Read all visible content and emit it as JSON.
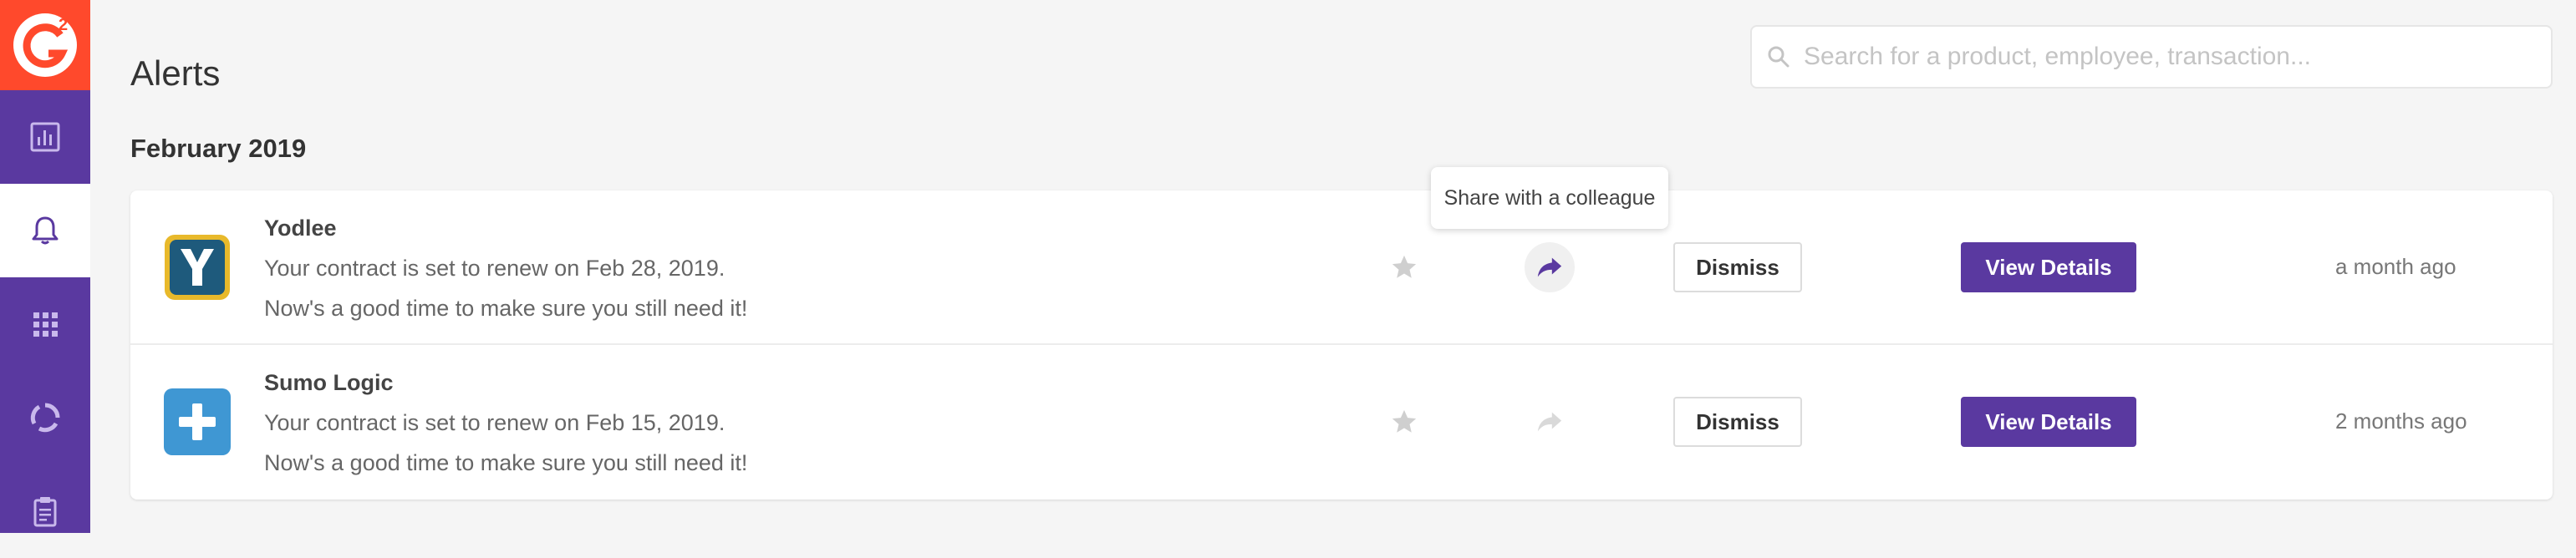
{
  "brand": {
    "logo_text": "G2",
    "logo_bg": "#ff492c",
    "accent": "#5a39a0"
  },
  "sidebar": {
    "items": [
      {
        "icon": "bar-chart-icon",
        "active": false
      },
      {
        "icon": "bell-icon",
        "active": true
      },
      {
        "icon": "grid-icon",
        "active": false
      },
      {
        "icon": "circle-progress-icon",
        "active": false
      },
      {
        "icon": "clipboard-icon",
        "active": false
      }
    ]
  },
  "search": {
    "placeholder": "Search for a product, employee, transaction..."
  },
  "page": {
    "title": "Alerts",
    "section": "February 2019"
  },
  "tooltip": {
    "text": "Share with a colleague"
  },
  "alerts": [
    {
      "vendor": "Yodlee",
      "line1": "Your contract is set to renew on Feb 28, 2019.",
      "line2": "Now's a good time to make sure you still need it!",
      "dismiss_label": "Dismiss",
      "view_label": "View Details",
      "time": "a month ago",
      "logo_icon": "yodlee-logo-icon"
    },
    {
      "vendor": "Sumo Logic",
      "line1": "Your contract is set to renew on Feb 15, 2019.",
      "line2": "Now's a good time to make sure you still need it!",
      "dismiss_label": "Dismiss",
      "view_label": "View Details",
      "time": "2 months ago",
      "logo_icon": "sumo-logic-logo-icon"
    }
  ]
}
